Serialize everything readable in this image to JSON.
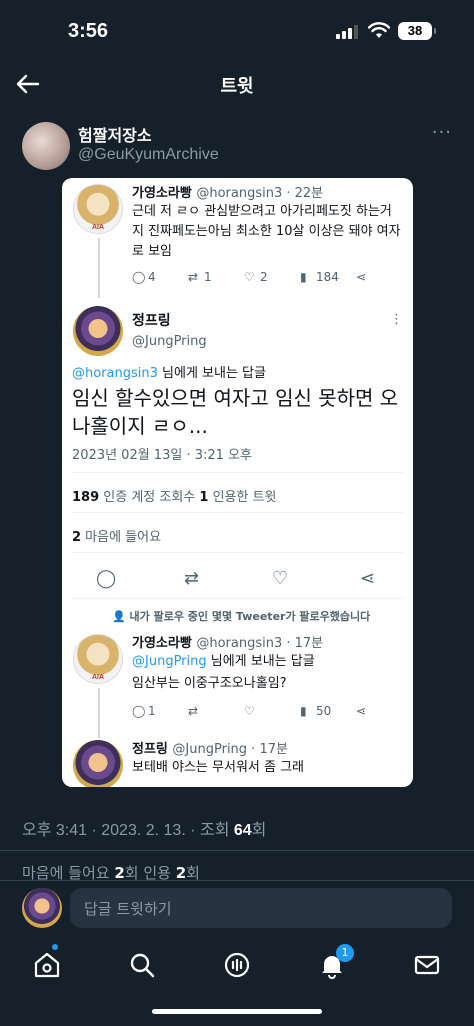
{
  "status": {
    "time": "3:56",
    "battery": "38"
  },
  "header": {
    "title": "트윗"
  },
  "author": {
    "name": "험짤저장소",
    "handle": "@GeuKyumArchive",
    "more": "···"
  },
  "screenshot": {
    "tweet1": {
      "name": "가영소라빵",
      "meta": "@horangsin3 · 22분",
      "text": "근데 저 ㄹㅇ 관심받으려고 아가리페도짓 하는거지 진짜페도는아님 최소한 10살 이상은 돼야 여자로 보임",
      "replies": "4",
      "retweets": "1",
      "likes": "2",
      "views": "184",
      "avatar_label": "AIA"
    },
    "main": {
      "name": "정프링",
      "handle": "@JungPring",
      "more": "⋮",
      "reply_to_handle": "@horangsin3",
      "reply_to_suffix": " 님에게 보내는 답글",
      "text": "임신 할수있으면 여자고 임신 못하면 오나홀이지 ㄹㅇ...",
      "timestamp": "2023년 02월 13일 · 3:21 오후",
      "views_count": "189",
      "views_label": " 인증 계정 조회수  ",
      "quotes_count": "1",
      "quotes_label": " 인용한 트윗",
      "likes_count": "2",
      "likes_label": " 마음에 들어요"
    },
    "social_context": "내가 팔로우 중인 몇몇 Tweeter가 팔로우했습니다",
    "tweet2": {
      "name": "가영소라빵",
      "meta": "@horangsin3 · 17분",
      "reply_to_handle": "@JungPring",
      "reply_to_suffix": " 님에게 보내는 답글",
      "text": "임산부는 이중구조오나홀임?",
      "replies": "1",
      "views": "50",
      "avatar_label": "AIA"
    },
    "tweet3": {
      "name": "정프링",
      "meta": "@JungPring · 17분",
      "text": "보테배 야스는 무서워서 좀 그래"
    }
  },
  "post": {
    "time_date": "오후 3:41 · 2023. 2. 13. · 조회 ",
    "views": "64",
    "views_suffix": "회",
    "likes_prefix": "마음에 들어요 ",
    "likes": "2",
    "likes_mid": "회  인용 ",
    "quotes": "2",
    "quotes_suffix": "회"
  },
  "reply": {
    "placeholder": "답글 트윗하기"
  },
  "tabbar": {
    "notifications_badge": "1"
  },
  "colors": {
    "background": "#15202b",
    "accent": "#1d9bf0",
    "muted": "#8b98a5"
  }
}
